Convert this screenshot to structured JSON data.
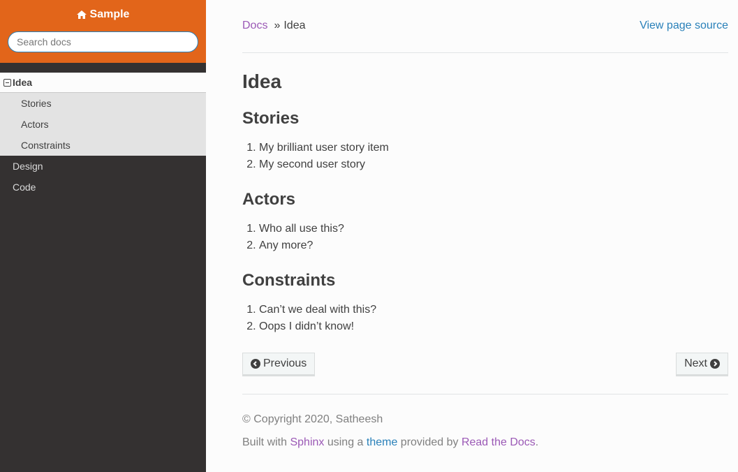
{
  "sidebar": {
    "brand": "Sample",
    "search_placeholder": "Search docs",
    "current": "Idea",
    "sub_items": [
      "Stories",
      "Actors",
      "Constraints"
    ],
    "items": [
      "Design",
      "Code"
    ]
  },
  "breadcrumb": {
    "root": "Docs",
    "separator": "»",
    "current": "Idea",
    "view_source": "View page source"
  },
  "page": {
    "title": "Idea",
    "sections": [
      {
        "heading": "Stories",
        "items": [
          "My brilliant user story item",
          "My second user story"
        ]
      },
      {
        "heading": "Actors",
        "items": [
          "Who all use this?",
          "Any more?"
        ]
      },
      {
        "heading": "Constraints",
        "items": [
          "Can’t we deal with this?",
          "Oops I didn’t know!"
        ]
      }
    ]
  },
  "pager": {
    "previous": "Previous",
    "next": "Next"
  },
  "footer": {
    "copyright": "© Copyright 2020, Satheesh",
    "built_prefix": "Built with ",
    "sphinx": "Sphinx",
    "using": " using a ",
    "theme": "theme",
    "provided": " provided by ",
    "rtd": "Read the Docs",
    "end": "."
  },
  "colors": {
    "brand": "#e2651a",
    "link": "#2980b9",
    "visited": "#9b59b6",
    "sidebar": "#343131"
  }
}
